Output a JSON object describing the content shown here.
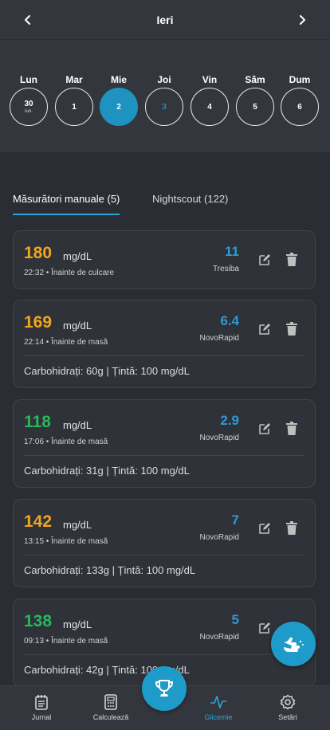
{
  "header": {
    "title": "Ieri"
  },
  "week": [
    {
      "name": "Lun",
      "num": "30",
      "sub": "iun."
    },
    {
      "name": "Mar",
      "num": "1",
      "sub": ""
    },
    {
      "name": "Mie",
      "num": "2",
      "sub": ""
    },
    {
      "name": "Joi",
      "num": "3",
      "sub": ""
    },
    {
      "name": "Vin",
      "num": "4",
      "sub": ""
    },
    {
      "name": "Sâm",
      "num": "5",
      "sub": ""
    },
    {
      "name": "Dum",
      "num": "6",
      "sub": ""
    }
  ],
  "tabs": {
    "manual": "Măsurători manuale (5)",
    "nightscout": "Nightscout (122)"
  },
  "entries": [
    {
      "value": "180",
      "unit": "mg/dL",
      "meta": "22:32 • Înainte de culcare",
      "insulin_value": "11",
      "insulin_name": "Tresiba",
      "carbs": ""
    },
    {
      "value": "169",
      "unit": "mg/dL",
      "meta": "22:14 • Înainte de masă",
      "insulin_value": "6.4",
      "insulin_name": "NovoRapid",
      "carbs": "Carbohidrați: 60g | Țintă: 100 mg/dL"
    },
    {
      "value": "118",
      "unit": "mg/dL",
      "meta": "17:06 • Înainte de masă",
      "insulin_value": "2.9",
      "insulin_name": "NovoRapid",
      "carbs": "Carbohidrați: 31g | Țintă: 100 mg/dL"
    },
    {
      "value": "142",
      "unit": "mg/dL",
      "meta": "13:15 • Înainte de masă",
      "insulin_value": "7",
      "insulin_name": "NovoRapid",
      "carbs": "Carbohidrați: 133g | Țintă: 100 mg/dL"
    },
    {
      "value": "138",
      "unit": "mg/dL",
      "meta": "09:13 • Înainte de masă",
      "insulin_value": "5",
      "insulin_name": "NovoRapid",
      "carbs": "Carbohidrați: 42g | Țintă: 100 mg/dL"
    }
  ],
  "bottom_nav": {
    "journal": "Jurnal",
    "calculator": "Calculează",
    "glycemia": "Glicemie",
    "settings": "Setări"
  },
  "colors": {
    "accent": "#1e9bc8",
    "high": "#f2a51f",
    "in_range": "#27b85a",
    "insulin": "#2e9ad6"
  },
  "icons": {
    "prev": "chevron-left-icon",
    "next": "chevron-right-icon",
    "edit": "edit-icon",
    "delete": "trash-icon",
    "fab": "hand-pointing-icon",
    "trophy": "trophy-icon"
  }
}
